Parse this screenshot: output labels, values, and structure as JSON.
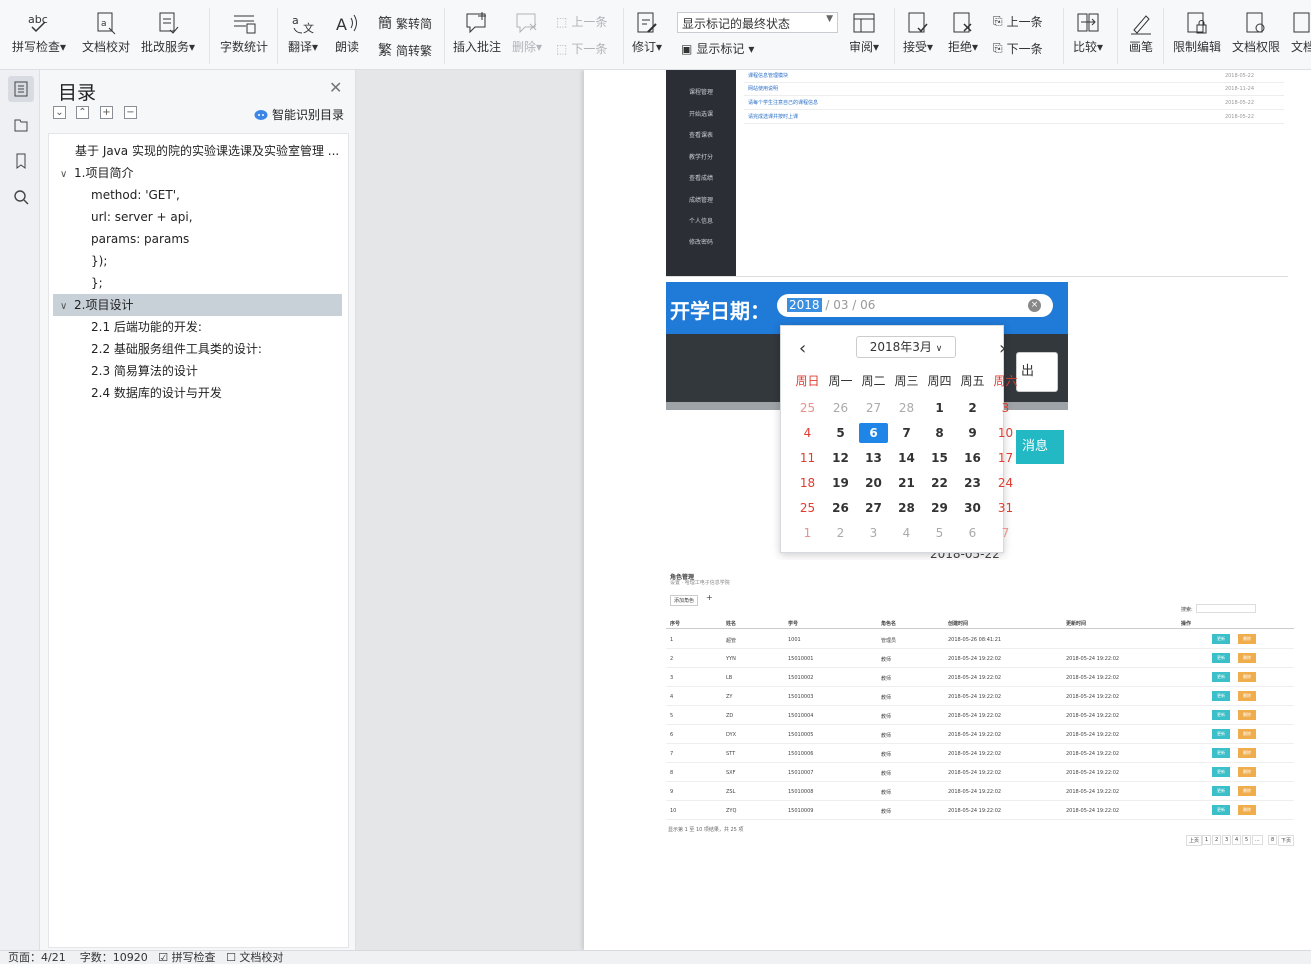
{
  "ribbon": {
    "spell": "拼写检查",
    "proofread": "文档校对",
    "correction": "批改服务",
    "wordcount": "字数统计",
    "translate": "翻译",
    "read": "朗读",
    "trad_to_simp": "繁转简",
    "simp_to_trad": "简转繁",
    "insert_comment": "插入批注",
    "delete": "删除",
    "prev_item": "上一条",
    "next_item": "下一条",
    "track": "修订",
    "markup_select": "显示标记的最终状态",
    "show_markup": "显示标记",
    "review": "审阅",
    "accept": "接受",
    "reject": "拒绝",
    "prev": "上一条",
    "next": "下一条",
    "compare": "比较",
    "pen": "画笔",
    "restrict": "限制编辑",
    "permission": "文档权限",
    "doc_more": "文档"
  },
  "toc": {
    "title": "目录",
    "smart_label": "智能识别目录",
    "items": [
      {
        "text": "基于 Java 实现的院的实验课选课及实验室管理 ..."
      },
      {
        "text": "1.项目简介"
      },
      {
        "text": "method: 'GET',"
      },
      {
        "text": "url: server + api,"
      },
      {
        "text": "params: params"
      },
      {
        "text": "});"
      },
      {
        "text": "};"
      },
      {
        "text": "2.项目设计"
      },
      {
        "text": "2.1 后端功能的开发:"
      },
      {
        "text": "2.2 基础服务组件工具类的设计:"
      },
      {
        "text": "2.3 简易算法的设计"
      },
      {
        "text": "2.4 数据库的设计与开发"
      }
    ]
  },
  "img1": {
    "nav": [
      "课程管理",
      "开始选课",
      "查看课表",
      "教学打分",
      "查看成绩",
      "成绩管理",
      "个人信息",
      "修改密码"
    ],
    "rows": [
      {
        "t": "课程信息管理模块",
        "d": "2018-05-22"
      },
      {
        "t": "网站使用说明",
        "d": "2018-11-24"
      },
      {
        "t": "请每个学生注意自己的课程信息",
        "d": "2018-05-22"
      },
      {
        "t": "请完成选课并按时上课",
        "d": "2018-05-22"
      }
    ]
  },
  "datepicker": {
    "label": "开学日期：",
    "year": "2018",
    "rest": " / 03 / 06",
    "clear": "×",
    "month_title": "2018年3月",
    "prev": "‹",
    "next": "›",
    "weekdays": [
      "周日",
      "周一",
      "周二",
      "周三",
      "周四",
      "周五",
      "周六"
    ],
    "days": [
      "25",
      "26",
      "27",
      "28",
      "1",
      "2",
      "3",
      "4",
      "5",
      "6",
      "7",
      "8",
      "9",
      "10",
      "11",
      "12",
      "13",
      "14",
      "15",
      "16",
      "17",
      "18",
      "19",
      "20",
      "21",
      "22",
      "23",
      "24",
      "25",
      "26",
      "27",
      "28",
      "29",
      "30",
      "31",
      "1",
      "2",
      "3",
      "4",
      "5",
      "6",
      "7"
    ],
    "selected": "6",
    "btn_logout": "出",
    "btn_msg": "消息",
    "ghost_date": "2018-05-22"
  },
  "img3": {
    "title": "角色管理",
    "breadcrumb": "设置 · 哈理工电子信息学院",
    "add": "添加角色",
    "search": "搜索:",
    "headers": [
      "序号",
      "姓名",
      "学号",
      "角色名",
      "创建时间",
      "更新时间",
      "操作"
    ],
    "rows": [
      [
        "1",
        "超管",
        "1001",
        "管理员",
        "2018-05-26 08:41:21",
        ""
      ],
      [
        "2",
        "YYN",
        "15010001",
        "教师",
        "2018-05-24 19:22:02",
        "2018-05-24 19:22:02"
      ],
      [
        "3",
        "LB",
        "15010002",
        "教师",
        "2018-05-24 19:22:02",
        "2018-05-24 19:22:02"
      ],
      [
        "4",
        "ZY",
        "15010003",
        "教师",
        "2018-05-24 19:22:02",
        "2018-05-24 19:22:02"
      ],
      [
        "5",
        "ZD",
        "15010004",
        "教师",
        "2018-05-24 19:22:02",
        "2018-05-24 19:22:02"
      ],
      [
        "6",
        "DYX",
        "15010005",
        "教师",
        "2018-05-24 19:22:02",
        "2018-05-24 19:22:02"
      ],
      [
        "7",
        "STT",
        "15010006",
        "教师",
        "2018-05-24 19:22:02",
        "2018-05-24 19:22:02"
      ],
      [
        "8",
        "SXF",
        "15010007",
        "教师",
        "2018-05-24 19:22:02",
        "2018-05-24 19:22:02"
      ],
      [
        "9",
        "ZSL",
        "15010008",
        "教师",
        "2018-05-24 19:22:02",
        "2018-05-24 19:22:02"
      ],
      [
        "10",
        "ZYQ",
        "15010009",
        "教师",
        "2018-05-24 19:22:02",
        "2018-05-24 19:22:02"
      ]
    ],
    "edit": "更新",
    "del": "删除",
    "footer": "显示第 1 至 10 项结果，共 25 项",
    "pager": [
      "上页",
      "1",
      "2",
      "3",
      "4",
      "5",
      "...",
      "8",
      "下页"
    ]
  },
  "status": {
    "page": "页面：4/21",
    "words": "字数：10920",
    "spell": "拼写检查",
    "proof": "文档校对"
  }
}
